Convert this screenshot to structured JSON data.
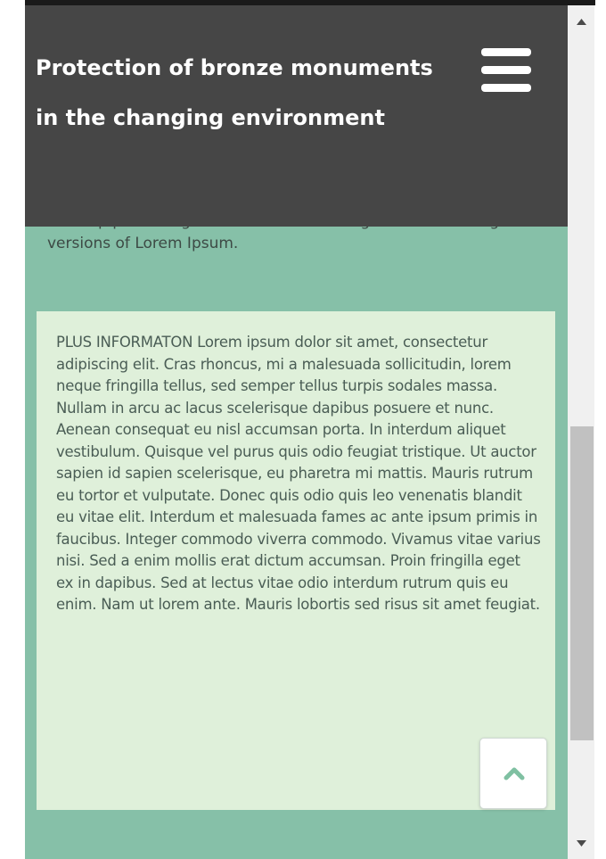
{
  "header": {
    "title": "Protection of bronze monuments in the changing environment",
    "menu_icon": "hamburger-menu-icon",
    "background": "#464646"
  },
  "intro": {
    "text": "desktop publishing software like Aldus PageMaker including versions of Lorem Ipsum."
  },
  "info_box": {
    "text": "PLUS INFORMATON Lorem ipsum dolor sit amet, consectetur adipiscing elit. Cras rhoncus, mi a malesuada sollicitudin, lorem neque fringilla tellus, sed semper tellus turpis sodales massa. Nullam in arcu ac lacus scelerisque dapibus posuere et nunc. Aenean consequat eu nisl accumsan porta. In interdum aliquet vestibulum. Quisque vel purus quis odio feugiat tristique. Ut auctor sapien id sapien scelerisque, eu pharetra mi mattis. Mauris rutrum eu tortor et vulputate. Donec quis odio quis leo venenatis blandit eu vitae elit. Interdum et malesuada fames ac ante ipsum primis in faucibus. Integer commodo viverra commodo. Vivamus vitae varius nisi. Sed a enim mollis erat dictum accumsan. Proin fringilla eget ex in dapibus. Sed at lectus vitae odio interdum rutrum quis eu enim. Nam ut lorem ante. Mauris lobortis sed risus sit amet feugiat.",
    "background": "#dff0da"
  },
  "scroll_top": {
    "icon": "chevron-up-icon",
    "color": "#7fc0a2"
  },
  "page": {
    "background": "#86c0a8"
  },
  "scrollbar": {
    "up_icon": "scroll-up-arrow-icon",
    "down_icon": "scroll-down-arrow-icon"
  }
}
